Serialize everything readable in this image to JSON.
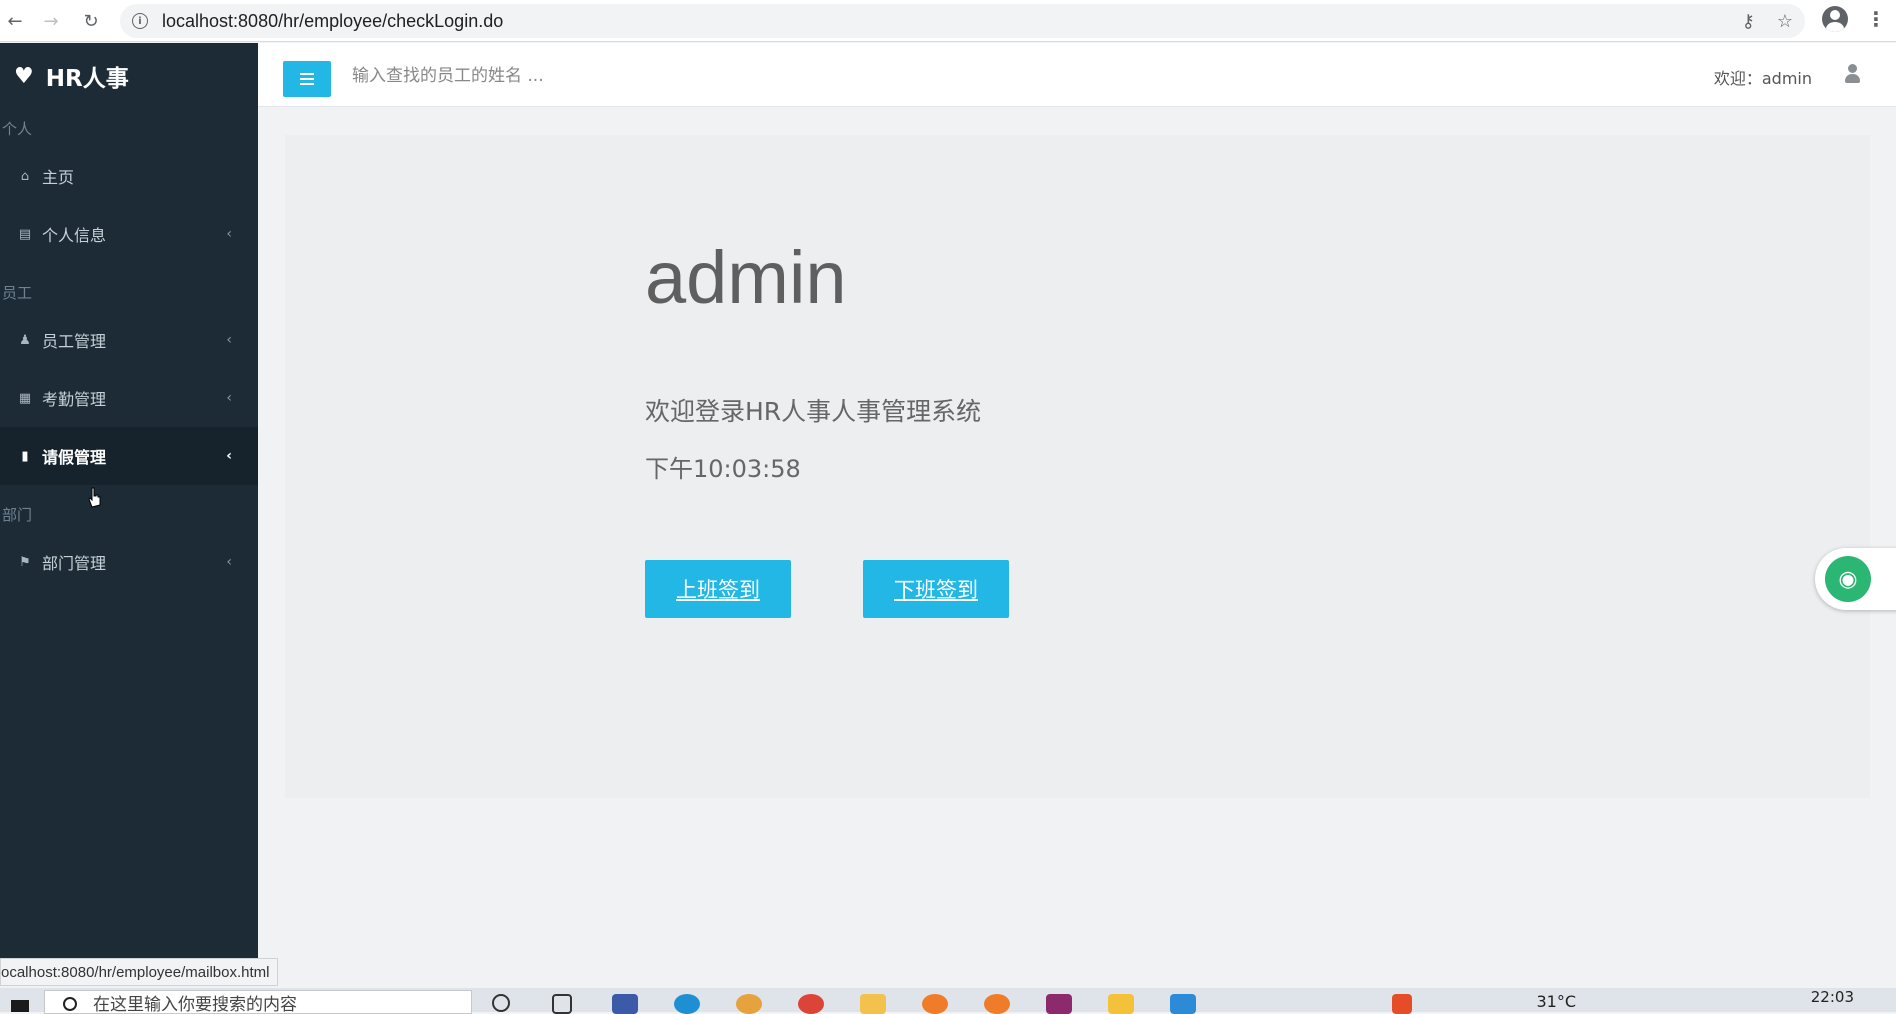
{
  "browser": {
    "url": "localhost:8080/hr/employee/checkLogin.do",
    "back_icon": "arrow-left-icon",
    "forward_icon": "arrow-right-icon",
    "reload_icon": "reload-icon"
  },
  "sidebar": {
    "brand": "HR人事",
    "sections": [
      {
        "label": "个人",
        "items": [
          {
            "label": "主页",
            "icon": "home-icon",
            "has_chevron": false
          },
          {
            "label": "个人信息",
            "icon": "id-card-icon",
            "has_chevron": true
          }
        ]
      },
      {
        "label": "员工",
        "items": [
          {
            "label": "员工管理",
            "icon": "user-icon",
            "has_chevron": true
          },
          {
            "label": "考勤管理",
            "icon": "calendar-icon",
            "has_chevron": true
          },
          {
            "label": "请假管理",
            "icon": "bookmark-icon",
            "has_chevron": true,
            "active": true
          }
        ]
      },
      {
        "label": "部门",
        "items": [
          {
            "label": "部门管理",
            "icon": "sitemap-icon",
            "has_chevron": true
          }
        ]
      }
    ]
  },
  "topbar": {
    "search_placeholder": "输入查找的员工的姓名 ...",
    "welcome": "欢迎：admin"
  },
  "main": {
    "name": "admin",
    "subtitle": "欢迎登录HR人事人事管理系统",
    "clock": "下午10:03:58",
    "checkin_label": "上班签到",
    "checkout_label": "下班签到"
  },
  "statusbar": {
    "hover_url": "ocalhost:8080/hr/employee/mailbox.html"
  },
  "taskbar": {
    "search_text": "在这里输入你要搜索的内容",
    "temperature": "31°C",
    "time": "22:03"
  },
  "colors": {
    "accent": "#23b7e5",
    "sidebar_bg": "#1c2b36",
    "sidebar_active": "#16232c"
  }
}
